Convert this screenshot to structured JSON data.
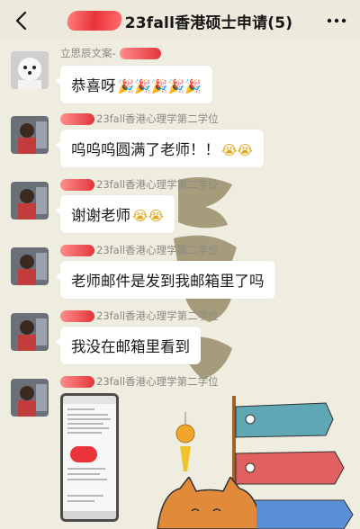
{
  "header": {
    "title": "23fall香港硕士申请(5)"
  },
  "messages": [
    {
      "sender": "立思辰文案-",
      "text": "恭喜呀",
      "emoji": "🎉🎉🎉🎉🎉"
    },
    {
      "sender": "23fall香港心理学第二学位",
      "text": "呜呜呜圆满了老师！！",
      "emoji": "😭😭"
    },
    {
      "sender": "23fall香港心理学第二学位",
      "text": "谢谢老师",
      "emoji": "😭😭"
    },
    {
      "sender": "23fall香港心理学第二学位",
      "text": "老师邮件是发到我邮箱里了吗",
      "emoji": ""
    },
    {
      "sender": "23fall香港心理学第二学位",
      "text": "我没在邮箱里看到",
      "emoji": ""
    },
    {
      "sender": "23fall香港心理学第二学位",
      "text": "",
      "emoji": ""
    }
  ],
  "colors": {
    "background": "#efece0",
    "bubble": "#ffffff",
    "redaction": "#e8343a"
  }
}
